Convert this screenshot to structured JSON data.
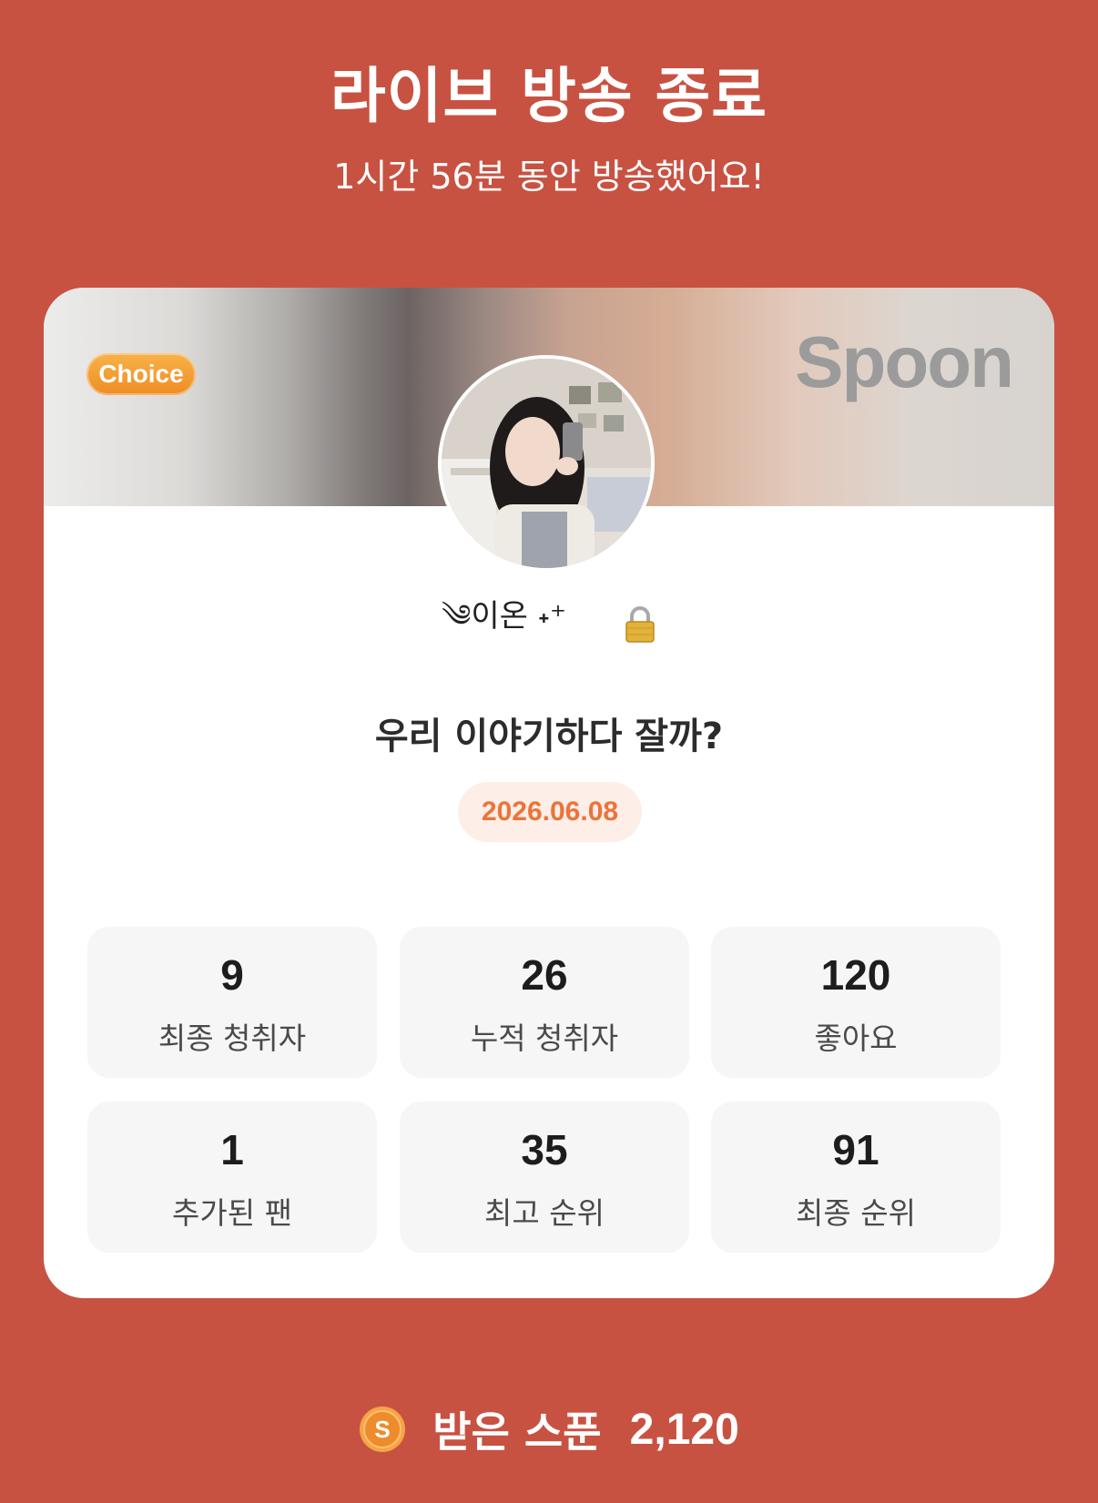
{
  "header": {
    "title": "라이브 방송 종료",
    "subtitle": "1시간 56분 동안 방송했어요!"
  },
  "card": {
    "badge": "Choice",
    "brand": "Spoon",
    "nickname": "༄이온 ˖⁺",
    "live_title": "우리 이야기하다 잘까?",
    "date": "2026.06.08",
    "stats": [
      {
        "value": "9",
        "label": "최종 청취자"
      },
      {
        "value": "26",
        "label": "누적 청취자"
      },
      {
        "value": "120",
        "label": "좋아요"
      },
      {
        "value": "1",
        "label": "추가된 팬"
      },
      {
        "value": "35",
        "label": "최고 순위"
      },
      {
        "value": "91",
        "label": "최종 순위"
      }
    ]
  },
  "footer": {
    "label": "받은 스푼",
    "value": "2,120"
  },
  "colors": {
    "background": "#C85242",
    "accent_orange": "#EC7339",
    "badge_orange": "#F29A2E"
  },
  "icons": {
    "lock": "lock-icon",
    "coin": "spoon-coin-icon"
  }
}
